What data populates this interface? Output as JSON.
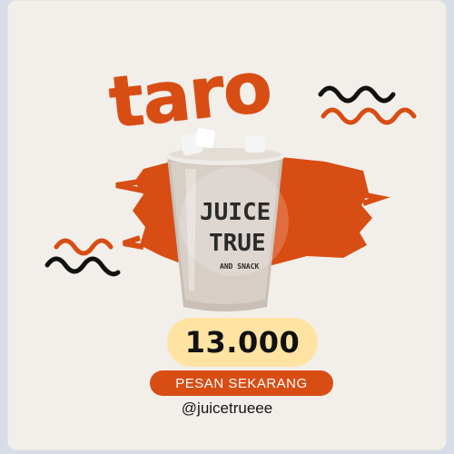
{
  "poster": {
    "title": "taro",
    "brand_line1": "JUICE",
    "brand_line2": "TRUE",
    "brand_subline": "AND SNACK",
    "price": "13.000",
    "cta_label": "PESAN SEKARANG",
    "handle": "@juicetrueee"
  },
  "colors": {
    "accent": "#d84d14",
    "price_pill": "#ffe3a2",
    "background": "#f2efea",
    "squiggle_dark": "#111111"
  },
  "icons": [
    "squiggle-decoration",
    "cup-illustration",
    "brush-stroke"
  ]
}
